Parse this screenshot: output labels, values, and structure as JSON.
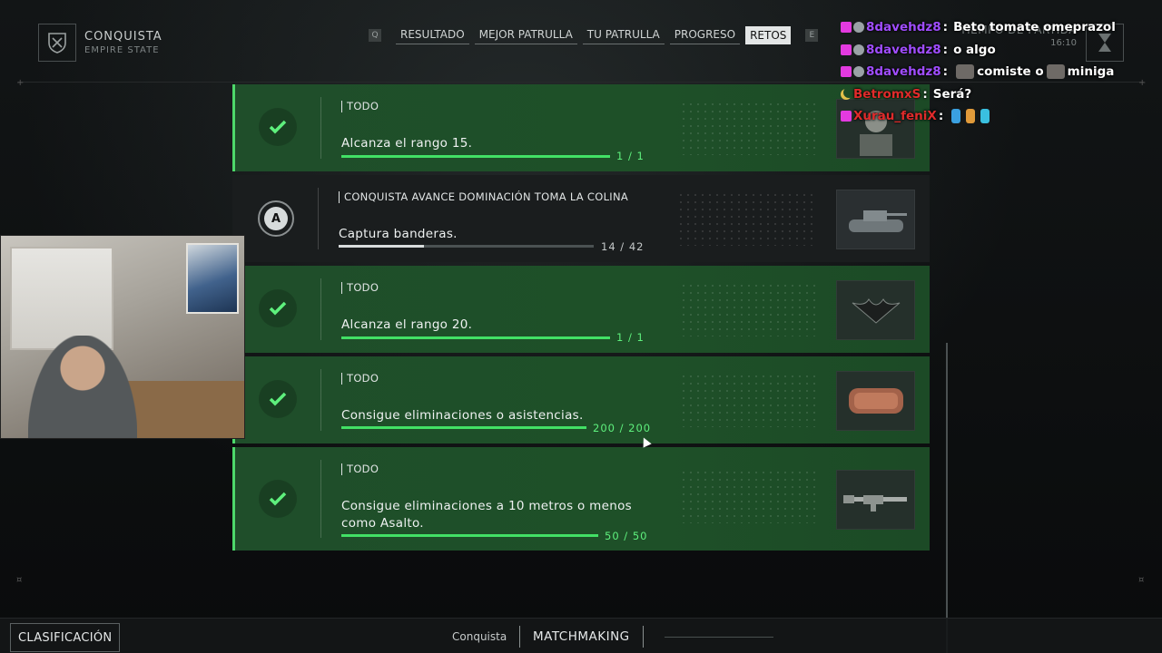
{
  "header": {
    "mode_title": "CONQUISTA",
    "mode_subtitle": "EMPIRE STATE",
    "left_key": "Q",
    "right_key": "E",
    "tabs": [
      {
        "label": "RESULTADO",
        "active": false
      },
      {
        "label": "MEJOR PATRULLA",
        "active": false
      },
      {
        "label": "TU PATRULLA",
        "active": false
      },
      {
        "label": "PROGRESO",
        "active": false
      },
      {
        "label": "RETOS",
        "active": true
      }
    ],
    "timer_label": "TIEMPO DE PARTIDA",
    "timer_value": "16:10"
  },
  "challenges": [
    {
      "category": "TODO",
      "description": "Alcanza el rango 15.",
      "progress_text": "1 / 1",
      "progress": 1.0,
      "completed": true,
      "thumb_icon": "soldier-portrait-icon"
    },
    {
      "category": "CONQUISTA AVANCE DOMINACIÓN TOMA LA COLINA",
      "description": "Captura banderas.",
      "progress_text": "14 / 42",
      "progress": 0.333,
      "completed": false,
      "status_letter": "A",
      "thumb_icon": "tank-icon"
    },
    {
      "category": "TODO",
      "description": "Alcanza el rango 20.",
      "progress_text": "1 / 1",
      "progress": 1.0,
      "completed": true,
      "thumb_icon": "batarang-charm-icon"
    },
    {
      "category": "TODO",
      "description": "Consigue eliminaciones o asistencias.",
      "progress_text": "200 / 200",
      "progress": 1.0,
      "completed": true,
      "thumb_icon": "dog-tag-icon"
    },
    {
      "category": "TODO",
      "description": "Consigue eliminaciones a 10 metros o menos como Asalto.",
      "progress_text": "50 / 50",
      "progress": 1.0,
      "completed": true,
      "thumb_icon": "rifle-icon"
    }
  ],
  "chat": [
    {
      "user": "8davehdz8",
      "user_color": "#a04dff",
      "badges": [
        "heart",
        "mod"
      ],
      "text": "Beto tomate omeprazol"
    },
    {
      "user": "8davehdz8",
      "user_color": "#a04dff",
      "badges": [
        "heart",
        "mod"
      ],
      "text": "o algo"
    },
    {
      "user": "8davehdz8",
      "user_color": "#a04dff",
      "badges": [
        "heart",
        "mod"
      ],
      "text_before": "",
      "text": "comiste o",
      "text_after": "miniga",
      "emotes": true
    },
    {
      "user": "BetromxS",
      "user_color": "#e02b2b",
      "badges": [
        "moon"
      ],
      "text": "Será?"
    },
    {
      "user": "Xurau_feniX",
      "user_color": "#e02b2b",
      "badges": [
        "heart"
      ],
      "text": ""
    }
  ],
  "bottom": {
    "classification_label": "CLASIFICACIÓN",
    "mode_label": "Conquista",
    "matchmaking_label": "MATCHMAKING"
  },
  "colors": {
    "complete_green": "#42e065",
    "row_green": "#1f4e2a"
  }
}
